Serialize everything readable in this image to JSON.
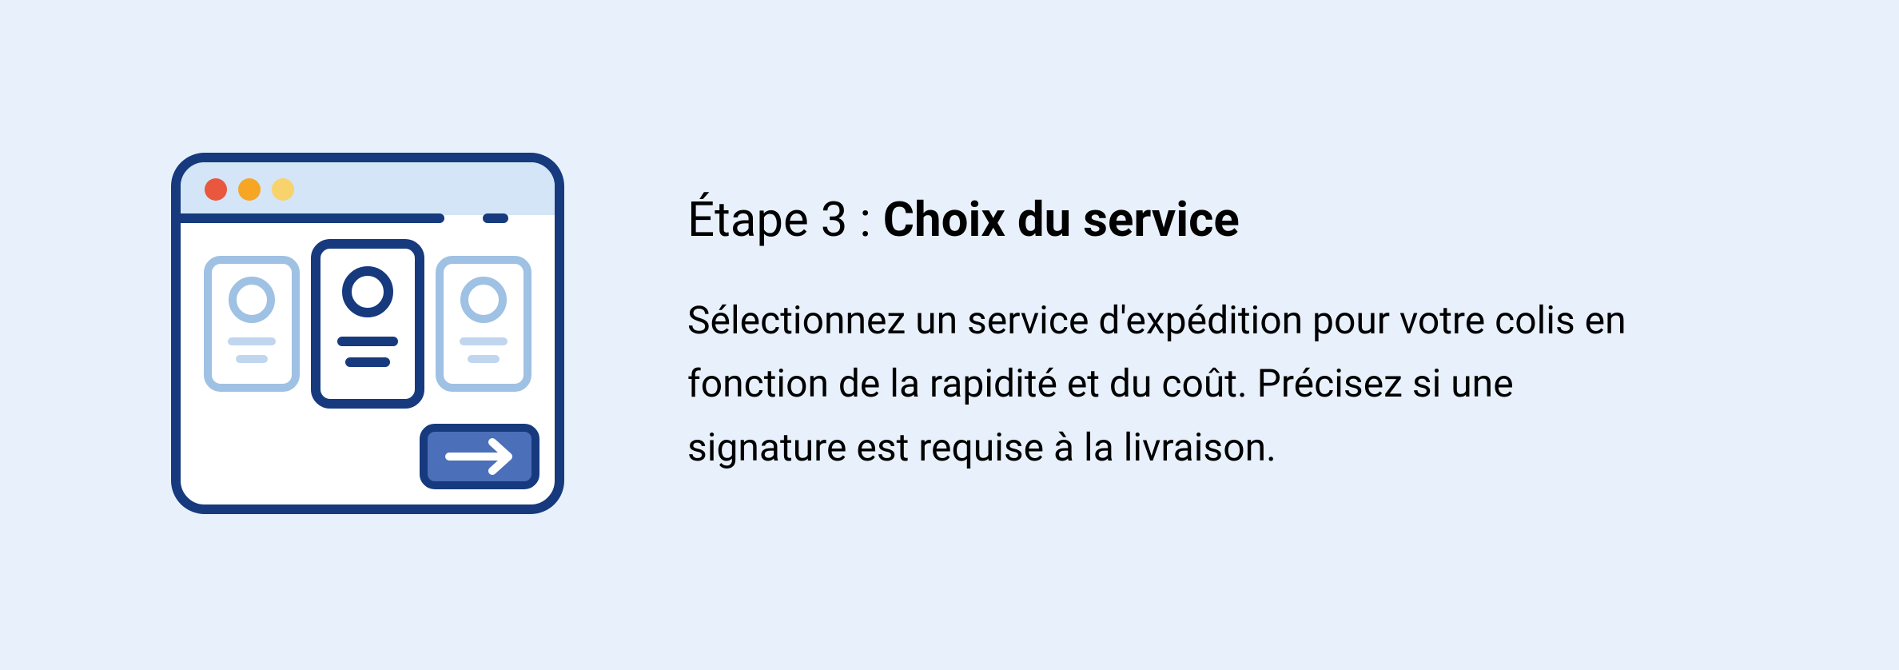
{
  "heading": {
    "prefix": "Étape 3 : ",
    "title": "Choix du service"
  },
  "body": "Sélectionnez un service d'expédition pour votre colis en fonction de la rapidité et du coût. Précisez si une signature est requise à la livraison.",
  "colors": {
    "bg": "#E8F1FB",
    "navy": "#163A7D",
    "lightblue": "#BFD6EE",
    "lightstroke": "#9FC1E3",
    "midblue": "#4B6FB8",
    "red": "#E9573F",
    "orange": "#F6A623",
    "yellow": "#F8D36B",
    "white": "#FFFFFF"
  },
  "icons": {
    "window": "browser-window",
    "traffic": [
      "traffic-dot-red",
      "traffic-dot-orange",
      "traffic-dot-yellow"
    ],
    "card": "option-card",
    "next": "arrow-right-icon"
  }
}
